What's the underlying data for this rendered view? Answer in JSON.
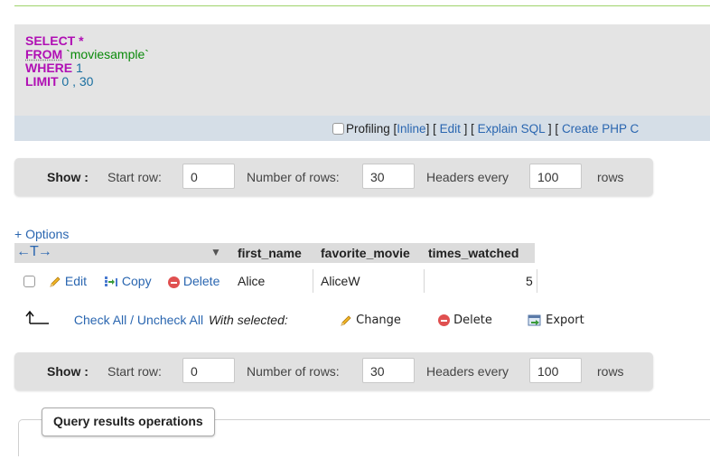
{
  "sql": {
    "line1_keyword": "SELECT",
    "line1_rest": " *",
    "line2_keyword": "FROM",
    "line2_rest": " `moviesample`",
    "line3_keyword": "WHERE",
    "line3_rest": " 1",
    "line4_keyword": "LIMIT",
    "line4_rest": " 0 , 30"
  },
  "sql_links": {
    "profiling": "Profiling",
    "inline": "Inline",
    "edit": "Edit",
    "explain": "Explain SQL",
    "create_php": "Create PHP C"
  },
  "nav": {
    "show_label": "Show :",
    "start_row_label": "Start row:",
    "start_row_value": "0",
    "num_rows_label": "Number of rows:",
    "num_rows_value": "30",
    "headers_every_label": "Headers every",
    "headers_every_value": "100",
    "rows_label": "rows"
  },
  "options_label": "+ Options",
  "table": {
    "arrows": "←T→",
    "columns": [
      "first_name",
      "favorite_movie",
      "times_watched"
    ],
    "rows": [
      {
        "edit_label": "Edit",
        "copy_label": "Copy",
        "delete_label": "Delete",
        "first_name": "Alice",
        "favorite_movie": "AliceW",
        "times_watched": "5"
      }
    ]
  },
  "bulk": {
    "check_all": "Check All / Uncheck All",
    "with_selected": "With selected:",
    "change": "Change",
    "delete": "Delete",
    "export": "Export"
  },
  "query_results_operations": "Query results operations",
  "colors": {
    "keyword": "#b00fb4",
    "string": "#0a8a0a",
    "number": "#1a6fa0",
    "link": "#2a66b0",
    "delete": "#e05050"
  },
  "icons": [
    "pencil-icon",
    "copy-icon",
    "delete-icon",
    "export-icon",
    "check-all-arrow-icon",
    "checkbox-icon",
    "sort-triangle-icon"
  ]
}
